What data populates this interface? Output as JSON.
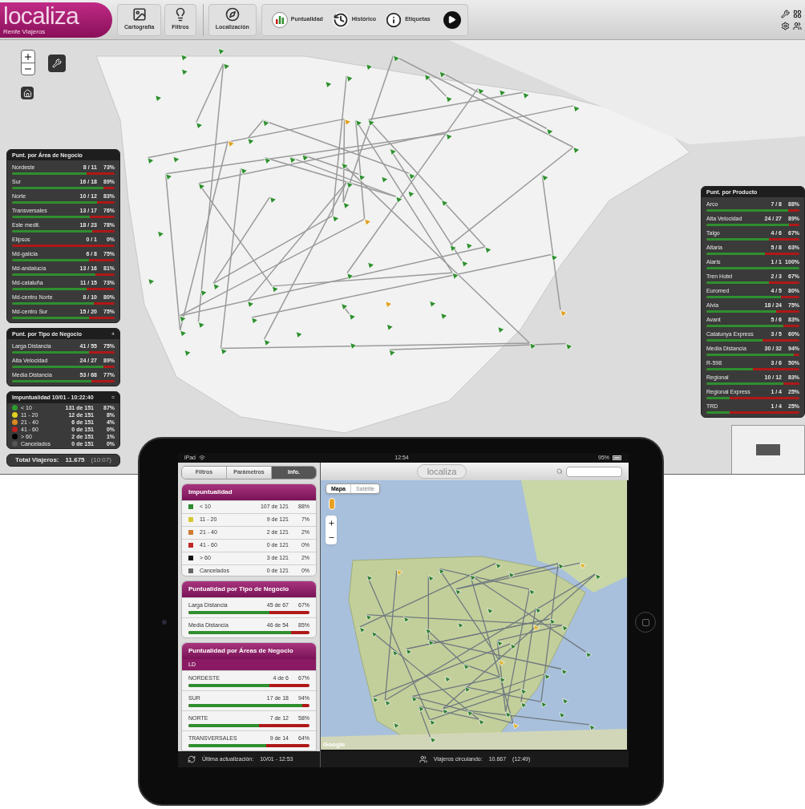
{
  "desktop": {
    "logo": {
      "name": "localiza",
      "subtitle": "Renfe Viajeros"
    },
    "toolbar": [
      {
        "label": "Cartografía",
        "kind": "stacked"
      },
      {
        "label": "Filtros",
        "kind": "stacked"
      },
      {
        "label": "Localización",
        "kind": "stacked"
      },
      {
        "label": "Puntualidad",
        "kind": "inline"
      },
      {
        "label": "Histórico",
        "kind": "inline"
      },
      {
        "label": "Etiquetas",
        "kind": "inline"
      },
      {
        "kind": "icon"
      }
    ],
    "area_panel": {
      "title": "Punt. por Área de Negocio",
      "rows": [
        {
          "label": "Nordeste",
          "count": "8 / 11",
          "percent": "73%",
          "level": 0.73
        },
        {
          "label": "Sur",
          "count": "16 / 18",
          "percent": "89%",
          "level": 0.89
        },
        {
          "label": "Norte",
          "count": "10 / 12",
          "percent": "83%",
          "level": 0.83
        },
        {
          "label": "Transversales",
          "count": "13 / 17",
          "percent": "76%",
          "level": 0.76
        },
        {
          "label": "Este medit.",
          "count": "18 / 23",
          "percent": "78%",
          "level": 0.78
        },
        {
          "label": "Elipsos",
          "count": "0 / 1",
          "percent": "0%",
          "level": 0
        },
        {
          "label": "Md-galicia",
          "count": "6 / 8",
          "percent": "75%",
          "level": 0.75
        },
        {
          "label": "Md-andalucía",
          "count": "13 / 16",
          "percent": "81%",
          "level": 0.81
        },
        {
          "label": "Md-cataluña",
          "count": "11 / 15",
          "percent": "73%",
          "level": 0.73
        },
        {
          "label": "Md-centro Norte",
          "count": "8 / 10",
          "percent": "80%",
          "level": 0.8
        },
        {
          "label": "Md-centro Sur",
          "count": "15 / 20",
          "percent": "75%",
          "level": 0.75
        }
      ]
    },
    "tipo_panel": {
      "title": "Punt. por Tipo de Negocio",
      "action": "+",
      "rows": [
        {
          "label": "Larga Distancia",
          "count": "41 / 55",
          "percent": "75%",
          "level": 0.75
        },
        {
          "label": "Alta Velocidad",
          "count": "24 / 27",
          "percent": "89%",
          "level": 0.89
        },
        {
          "label": "Media Distancia",
          "count": "53 / 68",
          "percent": "77%",
          "level": 0.77
        }
      ]
    },
    "impuntualidad_panel": {
      "title": "Impuntualidad 10/01 - 10:22:40",
      "action": "=",
      "rows": [
        {
          "label": "< 10",
          "count": "131 de 151",
          "percent": "87%",
          "color": "#2e9a2e"
        },
        {
          "label": "11 - 20",
          "count": "12 de 151",
          "percent": "8%",
          "color": "#e0d020"
        },
        {
          "label": "21 - 40",
          "count": "6 de 151",
          "percent": "4%",
          "color": "#d98a20"
        },
        {
          "label": "41 - 60",
          "count": "0 de 151",
          "percent": "0%",
          "color": "#c02020"
        },
        {
          "label": "> 60",
          "count": "2 de 151",
          "percent": "1%",
          "color": "#000000"
        },
        {
          "label": "Cancelados",
          "count": "0 de 151",
          "percent": "0%",
          "color": "#555555"
        }
      ]
    },
    "total": {
      "label": "Total Viajeros:",
      "value": "11.675",
      "time": "(10:07)"
    },
    "producto_panel": {
      "title": "Punt. por Producto",
      "rows": [
        {
          "label": "Arco",
          "count": "7 / 8",
          "percent": "88%",
          "level": 0.88
        },
        {
          "label": "Alta Velocidad",
          "count": "24 / 27",
          "percent": "89%",
          "level": 0.89
        },
        {
          "label": "Talgo",
          "count": "4 / 6",
          "percent": "67%",
          "level": 0.67
        },
        {
          "label": "Altaria",
          "count": "5 / 8",
          "percent": "63%",
          "level": 0.63
        },
        {
          "label": "Alaris",
          "count": "1 / 1",
          "percent": "100%",
          "level": 1
        },
        {
          "label": "Tren Hotel",
          "count": "2 / 3",
          "percent": "67%",
          "level": 0.67
        },
        {
          "label": "Euromed",
          "count": "4 / 5",
          "percent": "80%",
          "level": 0.8
        },
        {
          "label": "Alvia",
          "count": "18 / 24",
          "percent": "75%",
          "level": 0.75
        },
        {
          "label": "Avant",
          "count": "5 / 6",
          "percent": "83%",
          "level": 0.83
        },
        {
          "label": "Catalunya Express",
          "count": "3 / 5",
          "percent": "60%",
          "level": 0.6
        },
        {
          "label": "Media Distancia",
          "count": "30 / 32",
          "percent": "94%",
          "level": 0.94
        },
        {
          "label": "R-598",
          "count": "3 / 6",
          "percent": "50%",
          "level": 0.5
        },
        {
          "label": "Regional",
          "count": "10 / 12",
          "percent": "83%",
          "level": 0.83
        },
        {
          "label": "Regional Express",
          "count": "1 / 4",
          "percent": "25%",
          "level": 0.25
        },
        {
          "label": "TRD",
          "count": "1 / 4",
          "percent": "25%",
          "level": 0.25
        }
      ]
    }
  },
  "tablet": {
    "status": {
      "carrier": "iPad",
      "time": "12:54",
      "battery": "95%"
    },
    "tabs": [
      {
        "label": "Filtros",
        "selected": false
      },
      {
        "label": "Parámetros",
        "selected": false
      },
      {
        "label": "Info.",
        "selected": true
      }
    ],
    "impuntualidad": {
      "title": "Impuntualidad",
      "rows": [
        {
          "label": "< 10",
          "count": "107 de 121",
          "percent": "88%",
          "color": "#2e8b2e"
        },
        {
          "label": "11 - 20",
          "count": "9 de 121",
          "percent": "7%",
          "color": "#d8c830"
        },
        {
          "label": "21 - 40",
          "count": "2 de 121",
          "percent": "2%",
          "color": "#d07a30"
        },
        {
          "label": "41 - 60",
          "count": "0 de 121",
          "percent": "0%",
          "color": "#c02828"
        },
        {
          "label": "> 60",
          "count": "3 de 121",
          "percent": "2%",
          "color": "#111111"
        },
        {
          "label": "Cancelados",
          "count": "0 de 121",
          "percent": "0%",
          "color": "#666666"
        }
      ]
    },
    "tipo": {
      "title": "Puntualidad por Tipo de Negocio",
      "rows": [
        {
          "label": "Larga Distancia",
          "count": "45 de 67",
          "percent": "67%",
          "level": 0.67
        },
        {
          "label": "Media Distancia",
          "count": "46 de 54",
          "percent": "85%",
          "level": 0.85
        }
      ]
    },
    "areas": {
      "title": "Puntualidad por Áreas de Negocio",
      "subtitle": "LD",
      "rows": [
        {
          "label": "NORDESTE",
          "count": "4 de 6",
          "percent": "67%",
          "level": 0.67
        },
        {
          "label": "SUR",
          "count": "17 de 18",
          "percent": "94%",
          "level": 0.94
        },
        {
          "label": "NORTE",
          "count": "7 de 12",
          "percent": "58%",
          "level": 0.58
        },
        {
          "label": "TRANSVERSALES",
          "count": "9 de 14",
          "percent": "64%",
          "level": 0.64
        }
      ]
    },
    "update": {
      "label": "Última actualización:",
      "value": "10/01 - 12:53"
    },
    "logo": "localiza",
    "map_types": [
      {
        "label": "Mapa",
        "selected": true
      },
      {
        "label": "Satélite",
        "selected": false
      }
    ],
    "map_credit": "Google",
    "travellers": {
      "label": "Viajeros circulando:",
      "value": "10.667",
      "time": "(12:49)"
    }
  }
}
